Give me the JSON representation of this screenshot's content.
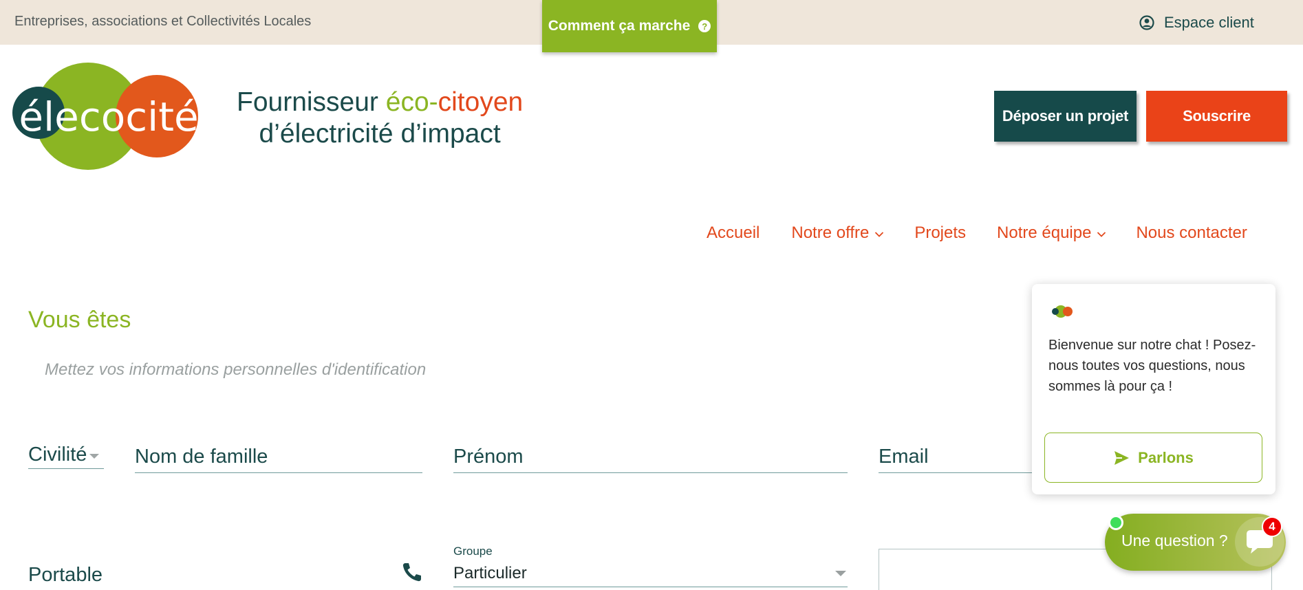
{
  "topbar": {
    "audience": "Entreprises, associations et Collectivités Locales",
    "how_it_works": "Comment ça marche",
    "client_space": "Espace client"
  },
  "brand": {
    "logo_text": "élecocité",
    "tagline_part1": "Fournisseur ",
    "tagline_eco": "éco-",
    "tagline_citoyen": "citoyen",
    "tagline_line2": "d’électricité d’impact"
  },
  "header_buttons": {
    "project": "Déposer un projet",
    "subscribe": "Souscrire"
  },
  "nav": [
    {
      "label": "Accueil",
      "dropdown": false
    },
    {
      "label": "Notre offre",
      "dropdown": true
    },
    {
      "label": "Projets",
      "dropdown": false
    },
    {
      "label": "Notre équipe",
      "dropdown": true
    },
    {
      "label": "Nous contacter",
      "dropdown": false
    }
  ],
  "form": {
    "title": "Vous êtes",
    "subtitle": "Mettez vos informations personnelles d'identification",
    "civility_label": "Civilité",
    "lastname_placeholder": "Nom de famille",
    "firstname_placeholder": "Prénom",
    "email_placeholder": "Email",
    "mobile_label": "Portable",
    "group_label": "Groupe",
    "group_value": "Particulier"
  },
  "chat": {
    "welcome": "Bienvenue sur notre chat ! Posez-nous toutes vos questions, nous sommes là pour ça !",
    "cta": "Parlons",
    "launcher_label": "Une question ?",
    "unread_count": "4"
  },
  "colors": {
    "green": "#8bb523",
    "orange": "#e2481c",
    "dark_teal": "#164a4a",
    "beige": "#efe6da"
  }
}
